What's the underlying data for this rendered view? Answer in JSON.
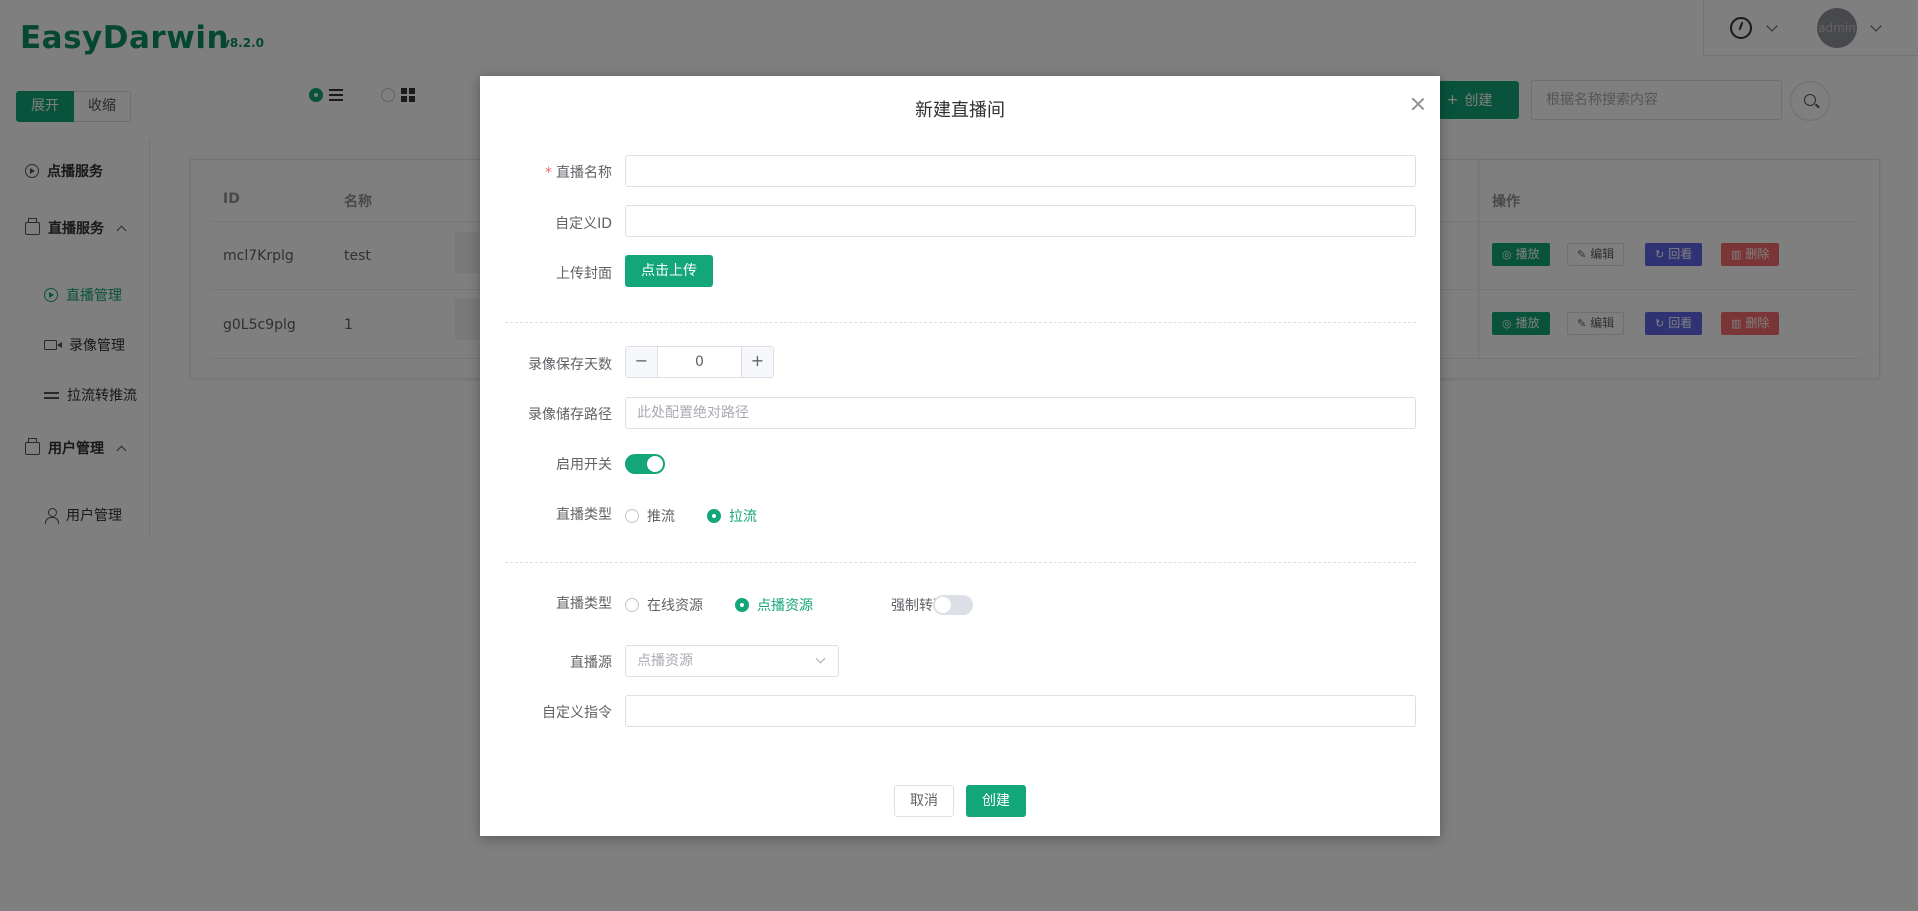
{
  "app": {
    "title": "EasyDarwin",
    "version": "v8.2.0"
  },
  "header": {
    "avatar_text": "admin",
    "icons": [
      "dashboard-icon",
      "chevron-down-icon"
    ]
  },
  "sidebar": {
    "expand_label": "展开",
    "collapse_label": "收缩",
    "items": [
      {
        "label": "点播服务"
      },
      {
        "label": "直播服务"
      },
      {
        "label": "直播管理"
      },
      {
        "label": "录像管理"
      },
      {
        "label": "拉流转推流"
      },
      {
        "label": "用户管理"
      },
      {
        "label": "用户管理"
      }
    ]
  },
  "toolbar": {
    "create_label": "创建",
    "search_placeholder": "根据名称搜索内容"
  },
  "table": {
    "headers": {
      "id": "ID",
      "name": "名称",
      "ops": "操作"
    },
    "rows": [
      {
        "id": "mcl7Krplg",
        "name": "test"
      },
      {
        "id": "g0L5c9plg",
        "name": "1"
      }
    ],
    "actions": {
      "play": "播放",
      "edit": "编辑",
      "replay": "回看",
      "delete": "删除"
    }
  },
  "dialog": {
    "title": "新建直播间",
    "fields": {
      "name_label": "直播名称",
      "custom_id_label": "自定义ID",
      "cover_label": "上传封面",
      "upload_button": "点击上传",
      "keep_days_label": "录像保存天数",
      "keep_days_value": "0",
      "path_label": "录像储存路径",
      "path_placeholder": "此处配置绝对路径",
      "enable_label": "启用开关",
      "enable_on": true,
      "live_type_label": "直播类型",
      "live_type_options": [
        "推流",
        "拉流"
      ],
      "live_type_selected": "拉流",
      "source_type_label": "直播类型",
      "source_type_options": [
        "在线资源",
        "点播资源"
      ],
      "source_type_selected": "点播资源",
      "transcode_label": "强制转码",
      "transcode_on": false,
      "source_label": "直播源",
      "source_placeholder": "点播资源",
      "command_label": "自定义指令"
    },
    "cancel_label": "取消",
    "create_label": "创建"
  },
  "colors": {
    "brand": "#13a679",
    "replay": "#6167e7",
    "danger": "#f56c6c"
  }
}
